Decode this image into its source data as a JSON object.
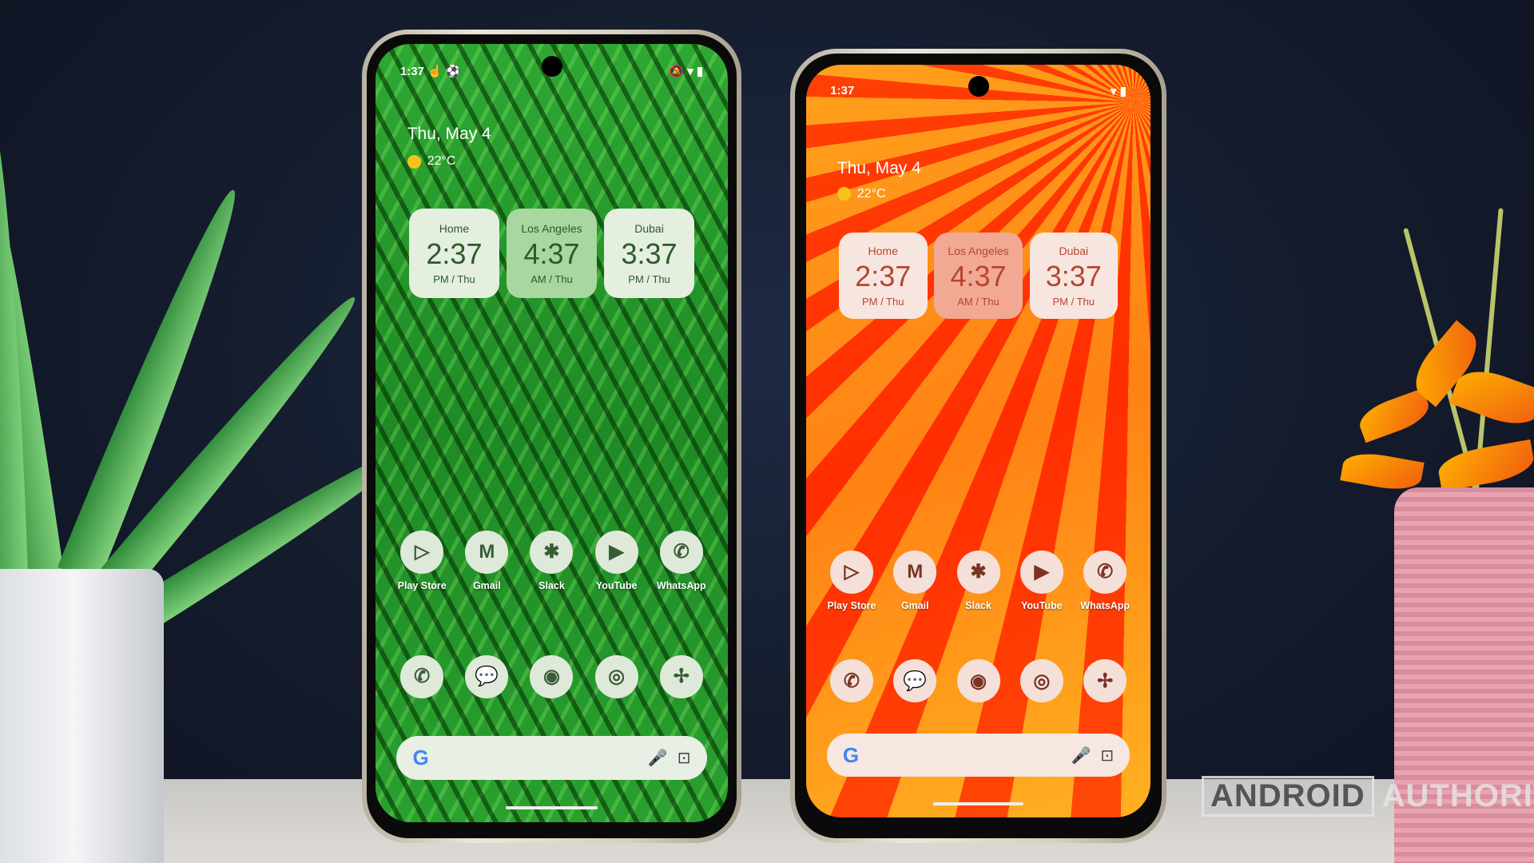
{
  "colors": {
    "left_accent": "#2d5a2a",
    "right_accent": "#b8452f",
    "sun": "#f7c31a"
  },
  "phones": [
    {
      "status_time": "1:37",
      "status_icons_left": "☝ ⚽",
      "status_icons_right": "🔕 ▾ ▮",
      "date": "Thu, May 4",
      "temp": "22°C",
      "clocks": [
        {
          "city": "Home",
          "time": "2:37",
          "sub": "PM / Thu"
        },
        {
          "city": "Los Angeles",
          "time": "4:37",
          "sub": "AM / Thu"
        },
        {
          "city": "Dubai",
          "time": "3:37",
          "sub": "PM / Thu"
        }
      ],
      "apps": [
        {
          "label": "Play Store",
          "icon": "play-store-icon",
          "glyph": "▷"
        },
        {
          "label": "Gmail",
          "icon": "gmail-icon",
          "glyph": "M"
        },
        {
          "label": "Slack",
          "icon": "slack-icon",
          "glyph": "✱"
        },
        {
          "label": "YouTube",
          "icon": "youtube-icon",
          "glyph": "▶"
        },
        {
          "label": "WhatsApp",
          "icon": "whatsapp-icon",
          "glyph": "✆"
        }
      ],
      "dock": [
        {
          "icon": "phone-icon",
          "glyph": "✆"
        },
        {
          "icon": "messages-icon",
          "glyph": "💬"
        },
        {
          "icon": "camera-icon",
          "glyph": "◉"
        },
        {
          "icon": "chrome-icon",
          "glyph": "◎"
        },
        {
          "icon": "pinwheel-icon",
          "glyph": "✢"
        }
      ],
      "search": {
        "g": "G",
        "mic": "🎤",
        "lens": "⊡"
      }
    },
    {
      "status_time": "1:37",
      "status_icons_left": "",
      "status_icons_right": "▾ ▮",
      "date": "Thu, May 4",
      "temp": "22°C",
      "clocks": [
        {
          "city": "Home",
          "time": "2:37",
          "sub": "PM / Thu"
        },
        {
          "city": "Los Angeles",
          "time": "4:37",
          "sub": "AM / Thu"
        },
        {
          "city": "Dubai",
          "time": "3:37",
          "sub": "PM / Thu"
        }
      ],
      "apps": [
        {
          "label": "Play Store",
          "icon": "play-store-icon",
          "glyph": "▷"
        },
        {
          "label": "Gmail",
          "icon": "gmail-icon",
          "glyph": "M"
        },
        {
          "label": "Slack",
          "icon": "slack-icon",
          "glyph": "✱"
        },
        {
          "label": "YouTube",
          "icon": "youtube-icon",
          "glyph": "▶"
        },
        {
          "label": "WhatsApp",
          "icon": "whatsapp-icon",
          "glyph": "✆"
        }
      ],
      "dock": [
        {
          "icon": "phone-icon",
          "glyph": "✆"
        },
        {
          "icon": "messages-icon",
          "glyph": "💬"
        },
        {
          "icon": "camera-icon",
          "glyph": "◉"
        },
        {
          "icon": "chrome-icon",
          "glyph": "◎"
        },
        {
          "icon": "pinwheel-icon",
          "glyph": "✢"
        }
      ],
      "search": {
        "g": "G",
        "mic": "🎤",
        "lens": "⊡"
      }
    }
  ],
  "watermark": {
    "part1": "ANDROID",
    "part2": "AUTHORITY"
  }
}
